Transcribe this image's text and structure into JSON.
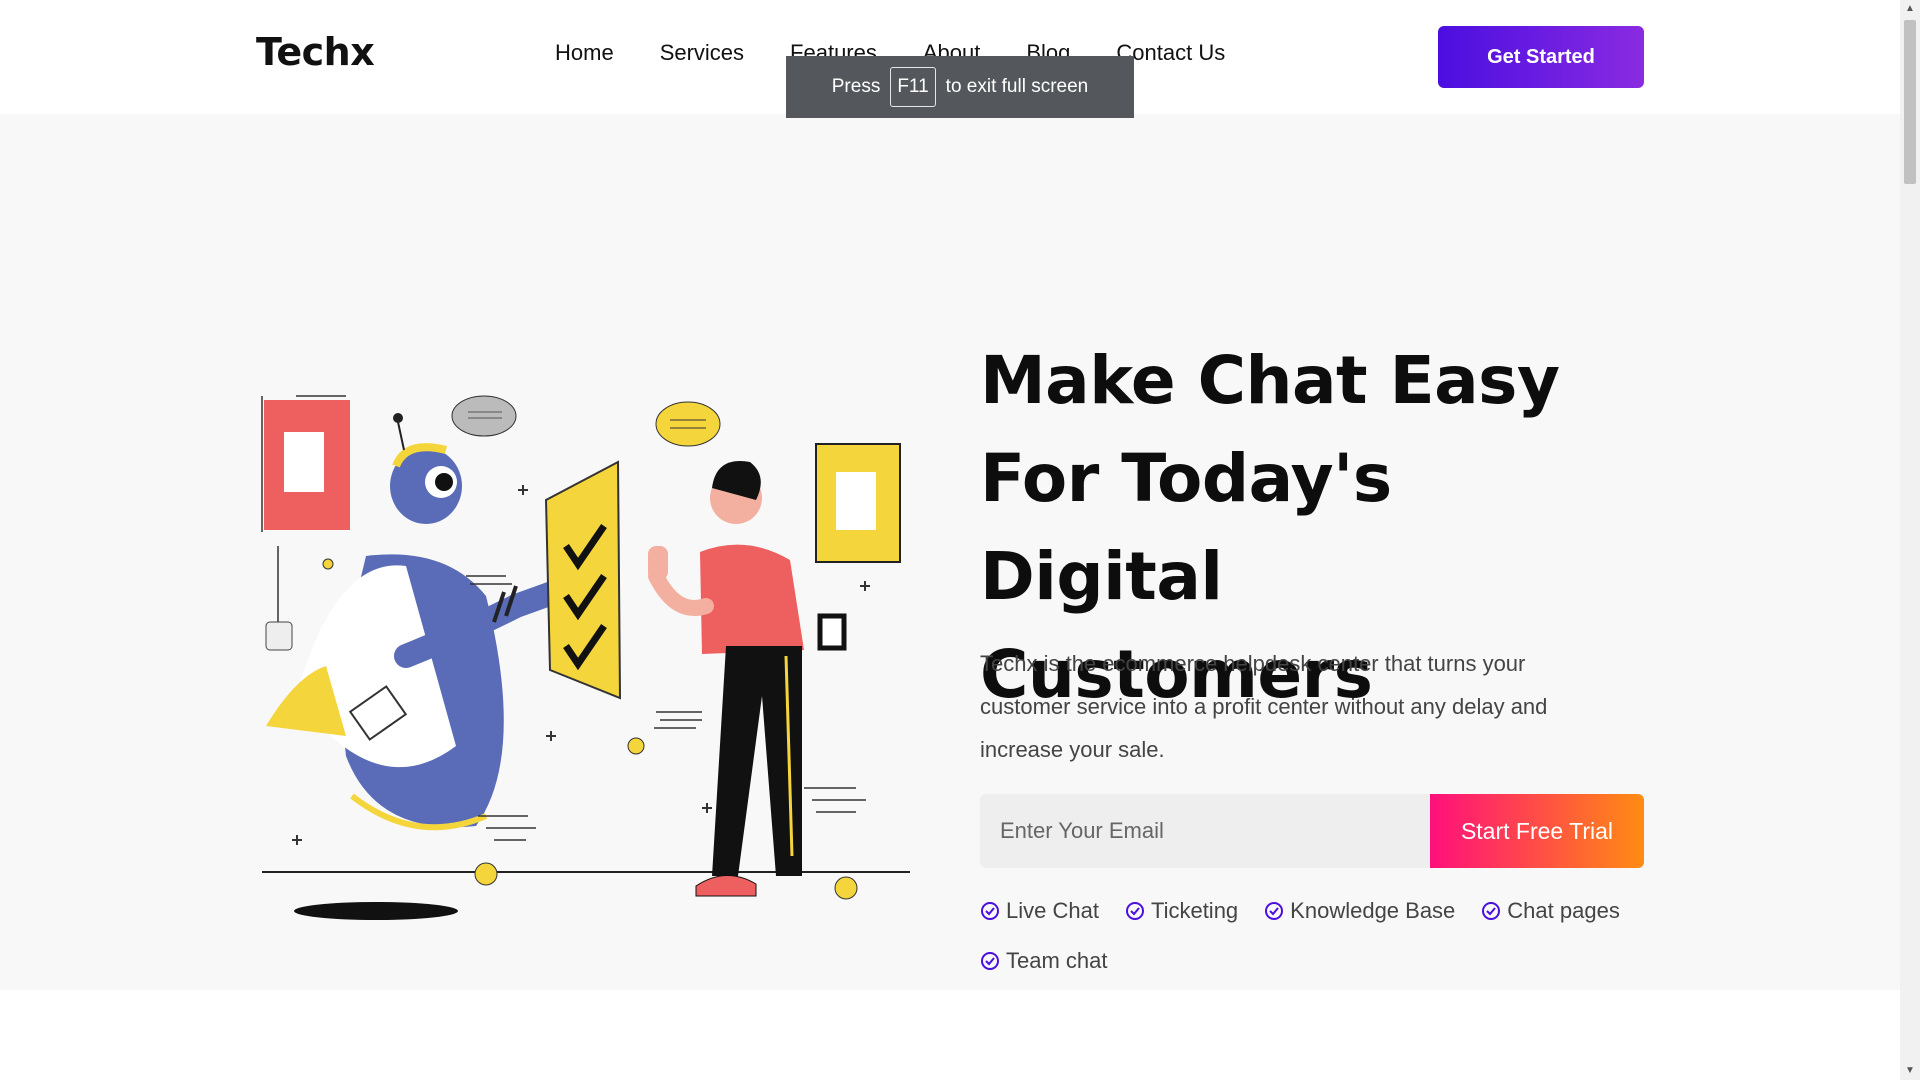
{
  "nav": {
    "logo": "Techx",
    "links": [
      "Home",
      "Services",
      "Features",
      "About",
      "Blog",
      "Contact Us"
    ],
    "cta_label": "Get Started"
  },
  "fullscreen_toast": {
    "prefix": "Press",
    "key": "F11",
    "suffix": "to exit full screen"
  },
  "hero": {
    "headline": "Make Chat Easy For Today's Digital Customers",
    "description": "Techx is the ecommerce helpdesk center that turns your customer service into a profit center without any delay and increase your sale.",
    "email_placeholder": "Enter Your Email",
    "trial_label": "Start Free Trial",
    "features": [
      "Live Chat",
      "Ticketing",
      "Knowledge Base",
      "Chat pages",
      "Team chat"
    ]
  },
  "colors": {
    "brand_gradient_start": "#4b0ee0",
    "brand_gradient_end": "#8a2be2",
    "trial_gradient_start": "#ff0f7b",
    "trial_gradient_end": "#ff8c12",
    "hero_bg": "#f8f8f8",
    "check": "#4b0ee0"
  },
  "icons": {
    "feature_check": "check-circle-icon",
    "illustration": "robot-chat-illustration"
  }
}
